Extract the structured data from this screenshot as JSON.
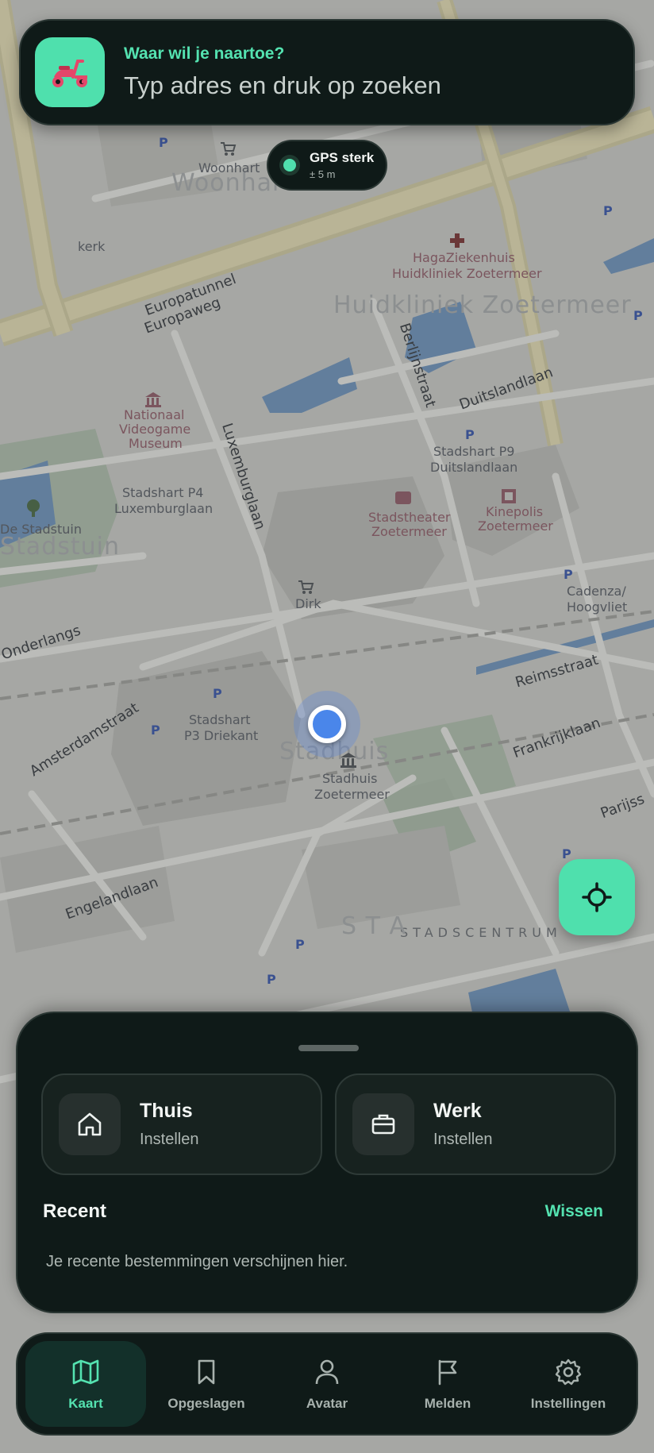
{
  "search": {
    "heading": "Waar wil je naartoe?",
    "placeholder": "Typ adres en druk op zoeken",
    "icon": "scooter-icon"
  },
  "gps": {
    "status": "GPS sterk",
    "accuracy": "± 5 m"
  },
  "map": {
    "labels": {
      "woonhart": "Woonhart",
      "woonhart_big": "Woonhart",
      "kerk": "kerk",
      "europatunnel": "Europatunnel",
      "europaweg": "Europaweg",
      "hagaziekenhuis": "HagaZiekenhuis",
      "huidkliniek": "Huidkliniek Zoetermeer",
      "huidkliniek_big": "Huidkliniek Zoetermeer",
      "berlijnstraat": "Berlijnstraat",
      "duitslandlaan": "Duitslandlaan",
      "stadshart_p9": "Stadshart P9",
      "stadshart_p9_sub": "Duitslandlaan",
      "nationaal": "Nationaal",
      "videogame": "Videogame",
      "museum": "Museum",
      "luxemburglaan": "Luxemburglaan",
      "stadshart_p4": "Stadshart P4",
      "stadshart_p4_sub": "Luxemburglaan",
      "stadstheater": "Stadstheater",
      "stadstheater_sub": "Zoetermeer",
      "kinepolis": "Kinepolis",
      "kinepolis_sub": "Zoetermeer",
      "de_stadstuin": "De Stadstuin",
      "stadstuin_big": "Stadstuin",
      "dirk": "Dirk",
      "cadenza": "Cadenza/",
      "hoogvliet": "Hoogvliet",
      "onderlangs": "Onderlangs",
      "reimsstraat": "Reimsstraat",
      "amsterdamstraat": "Amsterdamstraat",
      "stadshart_p3": "Stadshart",
      "stadshart_p3_sub": "P3 Driekant",
      "stadhuis_big": "Stadhuis",
      "stadhuis": "Stadhuis",
      "stadhuis_sub": "Zoetermeer",
      "frankrijklaan": "Frankrijklaan",
      "parijsstraat": "Parijss",
      "engelandlaan": "Engelandlaan",
      "stadscentrum": "STADSCENTRUM",
      "stadscentrum_big": "S T A"
    },
    "poi_marker": "P"
  },
  "locate": {
    "icon": "crosshair-icon"
  },
  "sheet": {
    "places": [
      {
        "title": "Thuis",
        "subtitle": "Instellen",
        "icon": "home-icon"
      },
      {
        "title": "Werk",
        "subtitle": "Instellen",
        "icon": "briefcase-icon"
      }
    ],
    "recent_title": "Recent",
    "clear_label": "Wissen",
    "empty_text": "Je recente bestemmingen verschijnen hier."
  },
  "nav": {
    "items": [
      {
        "label": "Kaart",
        "icon": "map-icon",
        "active": true
      },
      {
        "label": "Opgeslagen",
        "icon": "bookmark-icon",
        "active": false
      },
      {
        "label": "Avatar",
        "icon": "user-icon",
        "active": false
      },
      {
        "label": "Melden",
        "icon": "flag-icon",
        "active": false
      },
      {
        "label": "Instellingen",
        "icon": "gear-icon",
        "active": false
      }
    ]
  },
  "colors": {
    "accent": "#4fe0ad",
    "panel": "#0f1a18",
    "location": "#4a86ea"
  }
}
